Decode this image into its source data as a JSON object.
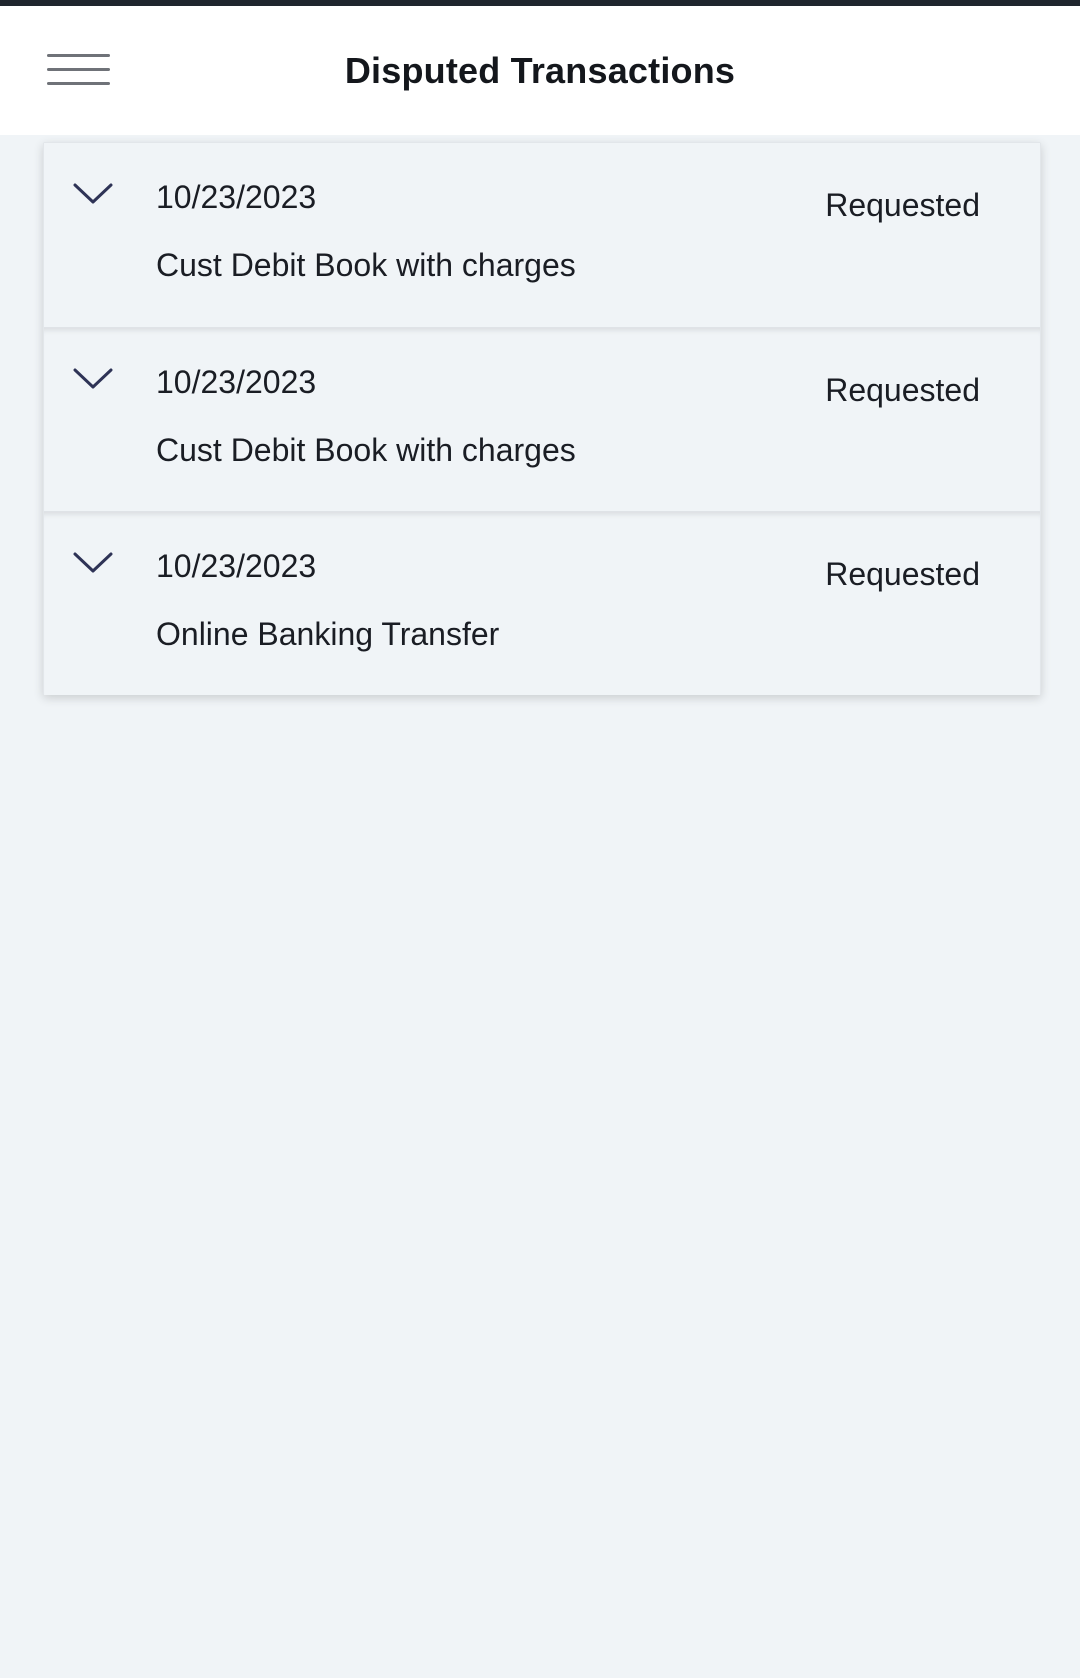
{
  "header": {
    "title": "Disputed Transactions",
    "menu_icon": "hamburger-menu-icon"
  },
  "colors": {
    "page_background": "#f0f4f7",
    "header_background": "#ffffff",
    "chevron": "#2e3356",
    "text": "#1a1d24"
  },
  "transactions": [
    {
      "date": "10/23/2023",
      "description": "Cust Debit Book with charges",
      "status": "Requested",
      "icon": "chevron-down-icon"
    },
    {
      "date": "10/23/2023",
      "description": "Cust Debit Book with charges",
      "status": "Requested",
      "icon": "chevron-down-icon"
    },
    {
      "date": "10/23/2023",
      "description": "Online Banking Transfer",
      "status": "Requested",
      "icon": "chevron-down-icon"
    }
  ]
}
